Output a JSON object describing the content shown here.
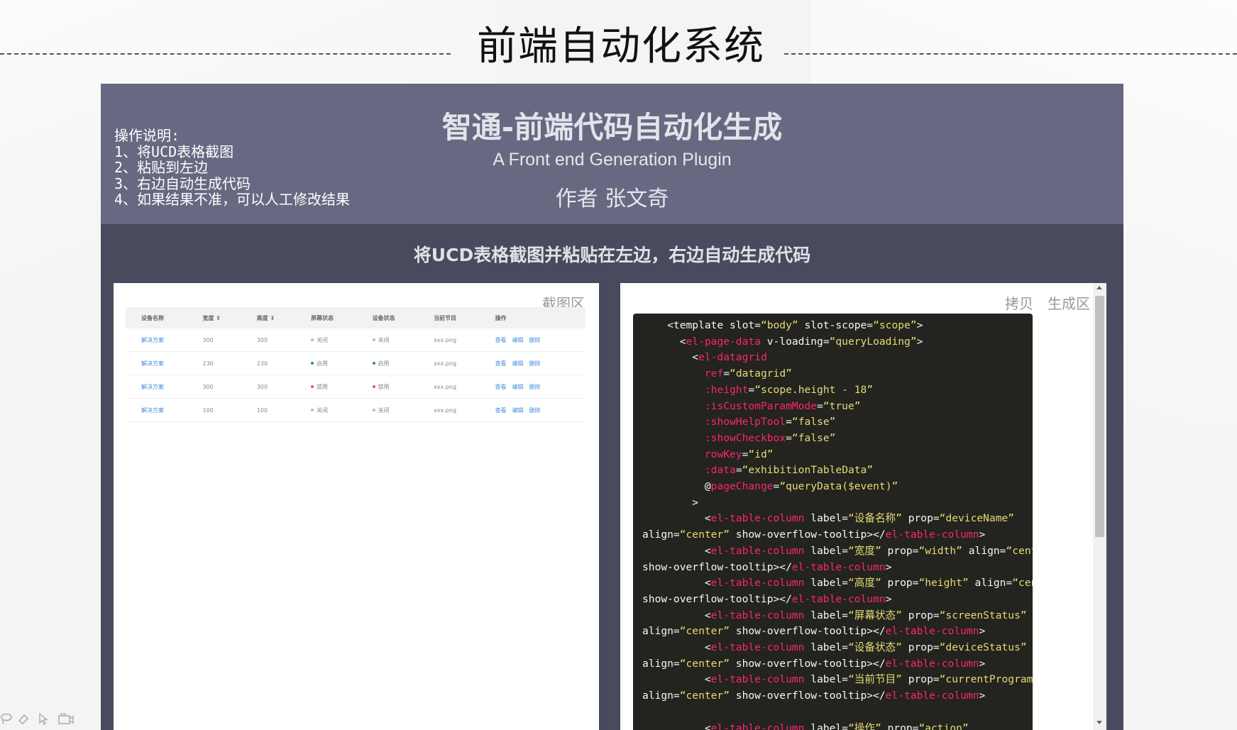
{
  "slide": {
    "title": "前端自动化系统"
  },
  "app": {
    "title": "智通-前端代码自动化生成",
    "subtitle": "A Front end Generation Plugin",
    "author": "作者 张文奇",
    "instructions": [
      "操作说明:",
      "1、将UCD表格截图",
      "2、粘贴到左边",
      "3、右边自动生成代码",
      "4、如果结果不准，可以人工修改结果"
    ],
    "banner": "将UCD表格截图并粘贴在左边，右边自动生成代码"
  },
  "left_panel": {
    "label": "截图区",
    "table": {
      "headers": [
        "设备名称",
        "宽度 ⇕",
        "高度 ⇕",
        "屏幕状态",
        "设备状态",
        "当前节目",
        "操作"
      ],
      "rows": [
        {
          "name": "解决方案",
          "width": "300",
          "height": "300",
          "screen": "关闭",
          "device": "关闭",
          "program": "xxx.png",
          "screen_color": "#bbbbbb",
          "device_color": "#bbbbbb"
        },
        {
          "name": "解决方案",
          "width": "230",
          "height": "230",
          "screen": "启用",
          "device": "启用",
          "program": "xxx.png",
          "screen_color": "#2ca02c",
          "device_color": "#2ca02c"
        },
        {
          "name": "解决方案",
          "width": "300",
          "height": "300",
          "screen": "禁用",
          "device": "禁用",
          "program": "xxx.png",
          "screen_color": "#e05a4a",
          "device_color": "#e05a4a"
        },
        {
          "name": "解决方案",
          "width": "100",
          "height": "100",
          "screen": "关闭",
          "device": "关闭",
          "program": "xxx.png",
          "screen_color": "#bbbbbb",
          "device_color": "#bbbbbb"
        }
      ],
      "ops": [
        "查看",
        "编辑",
        "删除"
      ]
    }
  },
  "right_panel": {
    "copy_label": "拷贝",
    "label": "生成区",
    "code_lines": [
      [
        {
          "c": "",
          "t": "    <template slot="
        },
        {
          "c": "s",
          "t": "“body”"
        },
        {
          "c": "",
          "t": " slot-scope="
        },
        {
          "c": "s",
          "t": "“scope”"
        },
        {
          "c": "",
          "t": ">"
        }
      ],
      [
        {
          "c": "",
          "t": "      <"
        },
        {
          "c": "t",
          "t": "el-page-data"
        },
        {
          "c": "",
          "t": " v-loading="
        },
        {
          "c": "s",
          "t": "“queryLoading”"
        },
        {
          "c": "",
          "t": ">"
        }
      ],
      [
        {
          "c": "",
          "t": "        <"
        },
        {
          "c": "t",
          "t": "el-datagrid"
        }
      ],
      [
        {
          "c": "",
          "t": "          "
        },
        {
          "c": "t",
          "t": "ref"
        },
        {
          "c": "",
          "t": "="
        },
        {
          "c": "s",
          "t": "“datagrid”"
        }
      ],
      [
        {
          "c": "",
          "t": "          "
        },
        {
          "c": "t",
          "t": ":height"
        },
        {
          "c": "",
          "t": "="
        },
        {
          "c": "s",
          "t": "“scope.height - 18”"
        }
      ],
      [
        {
          "c": "",
          "t": "          "
        },
        {
          "c": "t",
          "t": ":isCustomParamMode"
        },
        {
          "c": "",
          "t": "="
        },
        {
          "c": "s",
          "t": "“true”"
        }
      ],
      [
        {
          "c": "",
          "t": "          "
        },
        {
          "c": "t",
          "t": ":showHelpTool"
        },
        {
          "c": "",
          "t": "="
        },
        {
          "c": "s",
          "t": "“false”"
        }
      ],
      [
        {
          "c": "",
          "t": "          "
        },
        {
          "c": "t",
          "t": ":showCheckbox"
        },
        {
          "c": "",
          "t": "="
        },
        {
          "c": "s",
          "t": "“false”"
        }
      ],
      [
        {
          "c": "",
          "t": "          "
        },
        {
          "c": "t",
          "t": "rowKey"
        },
        {
          "c": "",
          "t": "="
        },
        {
          "c": "s",
          "t": "“id”"
        }
      ],
      [
        {
          "c": "",
          "t": "          "
        },
        {
          "c": "t",
          "t": ":data"
        },
        {
          "c": "",
          "t": "="
        },
        {
          "c": "s",
          "t": "“exhibitionTableData”"
        }
      ],
      [
        {
          "c": "",
          "t": "          @"
        },
        {
          "c": "t",
          "t": "pageChange"
        },
        {
          "c": "",
          "t": "="
        },
        {
          "c": "s",
          "t": "“queryData($event)”"
        }
      ],
      [
        {
          "c": "",
          "t": "        >"
        }
      ],
      [
        {
          "c": "",
          "t": "          <"
        },
        {
          "c": "t",
          "t": "el-table-column"
        },
        {
          "c": "",
          "t": " label="
        },
        {
          "c": "s",
          "t": "“设备名称”"
        },
        {
          "c": "",
          "t": " prop="
        },
        {
          "c": "s",
          "t": "“deviceName”"
        }
      ],
      [
        {
          "c": "",
          "t": "align="
        },
        {
          "c": "s",
          "t": "“center”"
        },
        {
          "c": "",
          "t": " show-overflow-tooltip></"
        },
        {
          "c": "t",
          "t": "el-table-column"
        },
        {
          "c": "",
          "t": ">"
        }
      ],
      [
        {
          "c": "",
          "t": "          <"
        },
        {
          "c": "t",
          "t": "el-table-column"
        },
        {
          "c": "",
          "t": " label="
        },
        {
          "c": "s",
          "t": "“宽度”"
        },
        {
          "c": "",
          "t": " prop="
        },
        {
          "c": "s",
          "t": "“width”"
        },
        {
          "c": "",
          "t": " align="
        },
        {
          "c": "s",
          "t": "“center”"
        }
      ],
      [
        {
          "c": "",
          "t": "show-overflow-tooltip></"
        },
        {
          "c": "t",
          "t": "el-table-column"
        },
        {
          "c": "",
          "t": ">"
        }
      ],
      [
        {
          "c": "",
          "t": "          <"
        },
        {
          "c": "t",
          "t": "el-table-column"
        },
        {
          "c": "",
          "t": " label="
        },
        {
          "c": "s",
          "t": "“高度”"
        },
        {
          "c": "",
          "t": " prop="
        },
        {
          "c": "s",
          "t": "“height”"
        },
        {
          "c": "",
          "t": " align="
        },
        {
          "c": "s",
          "t": "“center”"
        }
      ],
      [
        {
          "c": "",
          "t": "show-overflow-tooltip></"
        },
        {
          "c": "t",
          "t": "el-table-column"
        },
        {
          "c": "",
          "t": ">"
        }
      ],
      [
        {
          "c": "",
          "t": "          <"
        },
        {
          "c": "t",
          "t": "el-table-column"
        },
        {
          "c": "",
          "t": " label="
        },
        {
          "c": "s",
          "t": "“屏幕状态”"
        },
        {
          "c": "",
          "t": " prop="
        },
        {
          "c": "s",
          "t": "“screenStatus”"
        }
      ],
      [
        {
          "c": "",
          "t": "align="
        },
        {
          "c": "s",
          "t": "“center”"
        },
        {
          "c": "",
          "t": " show-overflow-tooltip></"
        },
        {
          "c": "t",
          "t": "el-table-column"
        },
        {
          "c": "",
          "t": ">"
        }
      ],
      [
        {
          "c": "",
          "t": "          <"
        },
        {
          "c": "t",
          "t": "el-table-column"
        },
        {
          "c": "",
          "t": " label="
        },
        {
          "c": "s",
          "t": "“设备状态”"
        },
        {
          "c": "",
          "t": " prop="
        },
        {
          "c": "s",
          "t": "“deviceStatus”"
        }
      ],
      [
        {
          "c": "",
          "t": "align="
        },
        {
          "c": "s",
          "t": "“center”"
        },
        {
          "c": "",
          "t": " show-overflow-tooltip></"
        },
        {
          "c": "t",
          "t": "el-table-column"
        },
        {
          "c": "",
          "t": ">"
        }
      ],
      [
        {
          "c": "",
          "t": "          <"
        },
        {
          "c": "t",
          "t": "el-table-column"
        },
        {
          "c": "",
          "t": " label="
        },
        {
          "c": "s",
          "t": "“当前节目”"
        },
        {
          "c": "",
          "t": " prop="
        },
        {
          "c": "s",
          "t": "“currentProgram”"
        }
      ],
      [
        {
          "c": "",
          "t": "align="
        },
        {
          "c": "s",
          "t": "“center”"
        },
        {
          "c": "",
          "t": " show-overflow-tooltip></"
        },
        {
          "c": "t",
          "t": "el-table-column"
        },
        {
          "c": "",
          "t": ">"
        }
      ],
      [
        {
          "c": "",
          "t": " "
        }
      ],
      [
        {
          "c": "",
          "t": "          <"
        },
        {
          "c": "t",
          "t": "el-table-column"
        },
        {
          "c": "",
          "t": " label="
        },
        {
          "c": "s",
          "t": "“操作”"
        },
        {
          "c": "",
          "t": " prop="
        },
        {
          "c": "s",
          "t": "“action”"
        }
      ]
    ]
  },
  "toolbar": {
    "icons": [
      "lasso-icon",
      "eraser-icon",
      "pointer-icon",
      "camera-icon"
    ]
  }
}
